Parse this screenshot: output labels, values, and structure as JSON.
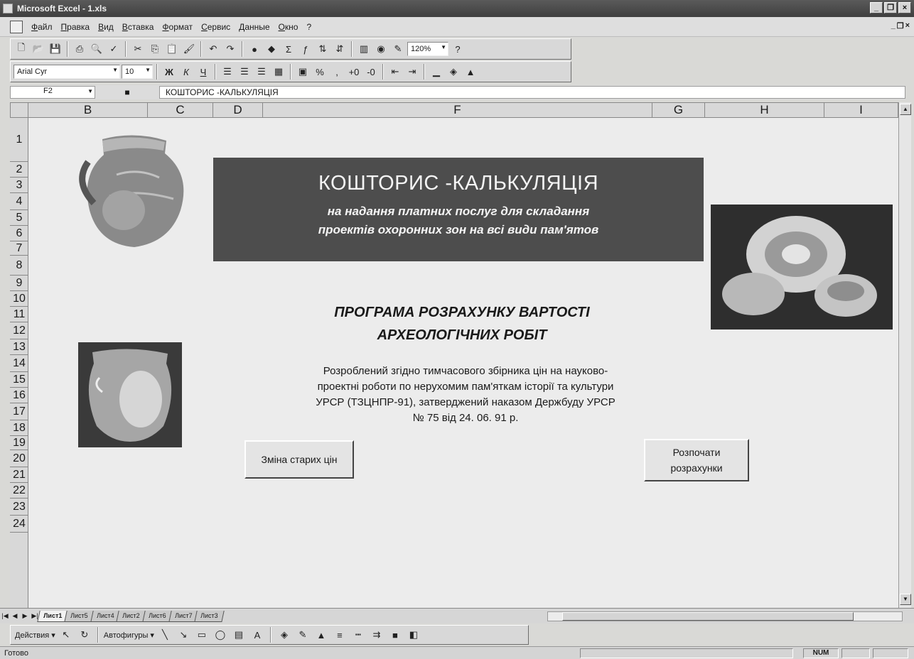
{
  "window": {
    "title": "Microsoft Excel - 1.xls"
  },
  "menu": {
    "items": [
      "Файл",
      "Правка",
      "Вид",
      "Вставка",
      "Формат",
      "Сервис",
      "Данные",
      "Окно",
      "?"
    ]
  },
  "standard_toolbar": {
    "zoom": "120%"
  },
  "format_toolbar": {
    "font": "Arial Cyr",
    "size": "10"
  },
  "formula_bar": {
    "cell": "F2",
    "content": "КОШТОРИС -КАЛЬКУЛЯЦІЯ"
  },
  "columns": [
    "B",
    "C",
    "D",
    "F",
    "G",
    "H",
    "I"
  ],
  "rows": [
    "1",
    "2",
    "3",
    "4",
    "5",
    "6",
    "7",
    "8",
    "9",
    "10",
    "11",
    "12",
    "13",
    "14",
    "15",
    "16",
    "17",
    "18",
    "19",
    "20",
    "21",
    "22",
    "23",
    "24"
  ],
  "banner": {
    "title": "КОШТОРИС -КАЛЬКУЛЯЦІЯ",
    "subtitle_line1": "на надання платних послуг для складання",
    "subtitle_line2": "проектів охоронних зон на всі види пам'ятов"
  },
  "program": {
    "title_line1": "ПРОГРАМА РОЗРАХУНКУ ВАРТОСТІ",
    "title_line2": "АРХЕОЛОГІЧНИХ РОБІТ",
    "desc_line1": "Розроблений згідно тимчасового збірника цін на науково-",
    "desc_line2": "проектні роботи по нерухомим пам'яткам історії та культури",
    "desc_line3": "УРСР (ТЗЦНПР-91), затверджений наказом Держбуду УРСР",
    "desc_line4": "№ 75 від 24. 06. 91 р."
  },
  "buttons": {
    "old_prices": "Зміна старих цін",
    "start_line1": "Розпочати",
    "start_line2": "розрахунки"
  },
  "sheet_tabs": [
    "Лист1",
    "Лист5",
    "Лист4",
    "Лист2",
    "Лист6",
    "Лист7",
    "Лист3"
  ],
  "drawing_toolbar": {
    "actions": "Действия",
    "autoshapes": "Автофигуры"
  },
  "status": {
    "ready": "Готово",
    "num": "NUM"
  },
  "icons": [
    "excel-icon",
    "new-icon",
    "open-icon",
    "save-icon",
    "print-icon",
    "preview-icon",
    "spelling-icon",
    "cut-icon",
    "copy-icon",
    "paste-icon",
    "format-painter-icon",
    "undo-icon",
    "redo-icon",
    "autosum-icon",
    "function-icon",
    "sort-asc-icon",
    "sort-desc-icon",
    "chart-wizard-icon",
    "drawing-icon",
    "help-icon"
  ]
}
